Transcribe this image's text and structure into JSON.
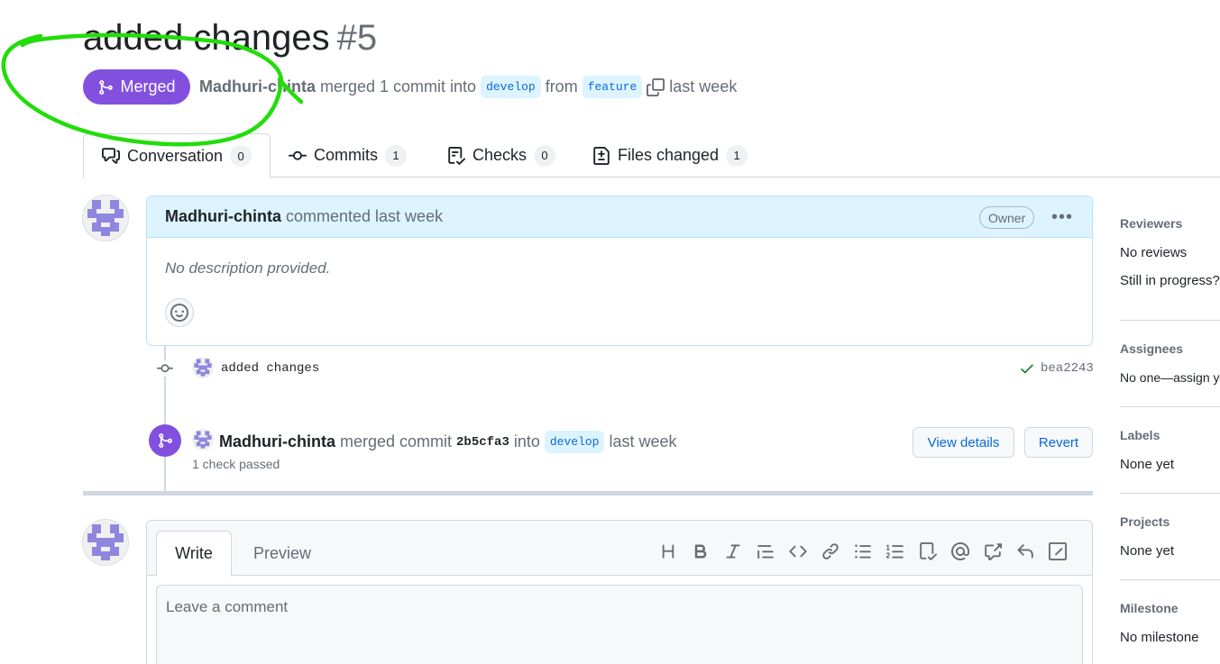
{
  "pr": {
    "title": "added changes",
    "number": "#5",
    "state": "Merged",
    "author": "Madhuri-chinta",
    "action": "merged 1 commit into",
    "base_branch": "develop",
    "from_word": "from",
    "head_branch": "feature",
    "time": "last week"
  },
  "tabs": [
    {
      "label": "Conversation",
      "count": "0"
    },
    {
      "label": "Commits",
      "count": "1"
    },
    {
      "label": "Checks",
      "count": "0"
    },
    {
      "label": "Files changed",
      "count": "1"
    }
  ],
  "comment": {
    "author": "Madhuri-chinta",
    "meta": "commented last week",
    "badge": "Owner",
    "body": "No description provided."
  },
  "commit": {
    "message": "added changes",
    "sha": "bea2243"
  },
  "merge_event": {
    "author": "Madhuri-chinta",
    "action": "merged commit",
    "sha": "2b5cfa3",
    "into": "into",
    "branch": "develop",
    "time": "last week",
    "checks": "1 check passed",
    "view_details": "View details",
    "revert": "Revert"
  },
  "new_comment": {
    "write_tab": "Write",
    "preview_tab": "Preview",
    "placeholder": "Leave a comment"
  },
  "sidebar": {
    "reviewers": {
      "title": "Reviewers",
      "value": "No reviews",
      "extra": "Still in progress?"
    },
    "assignees": {
      "title": "Assignees",
      "value": "No one—assign yourself"
    },
    "labels": {
      "title": "Labels",
      "value": "None yet"
    },
    "projects": {
      "title": "Projects",
      "value": "None yet"
    },
    "milestone": {
      "title": "Milestone",
      "value": "No milestone"
    }
  },
  "colors": {
    "merged": "#8250df",
    "link": "#0969da",
    "annotation": "#22dd0a"
  }
}
